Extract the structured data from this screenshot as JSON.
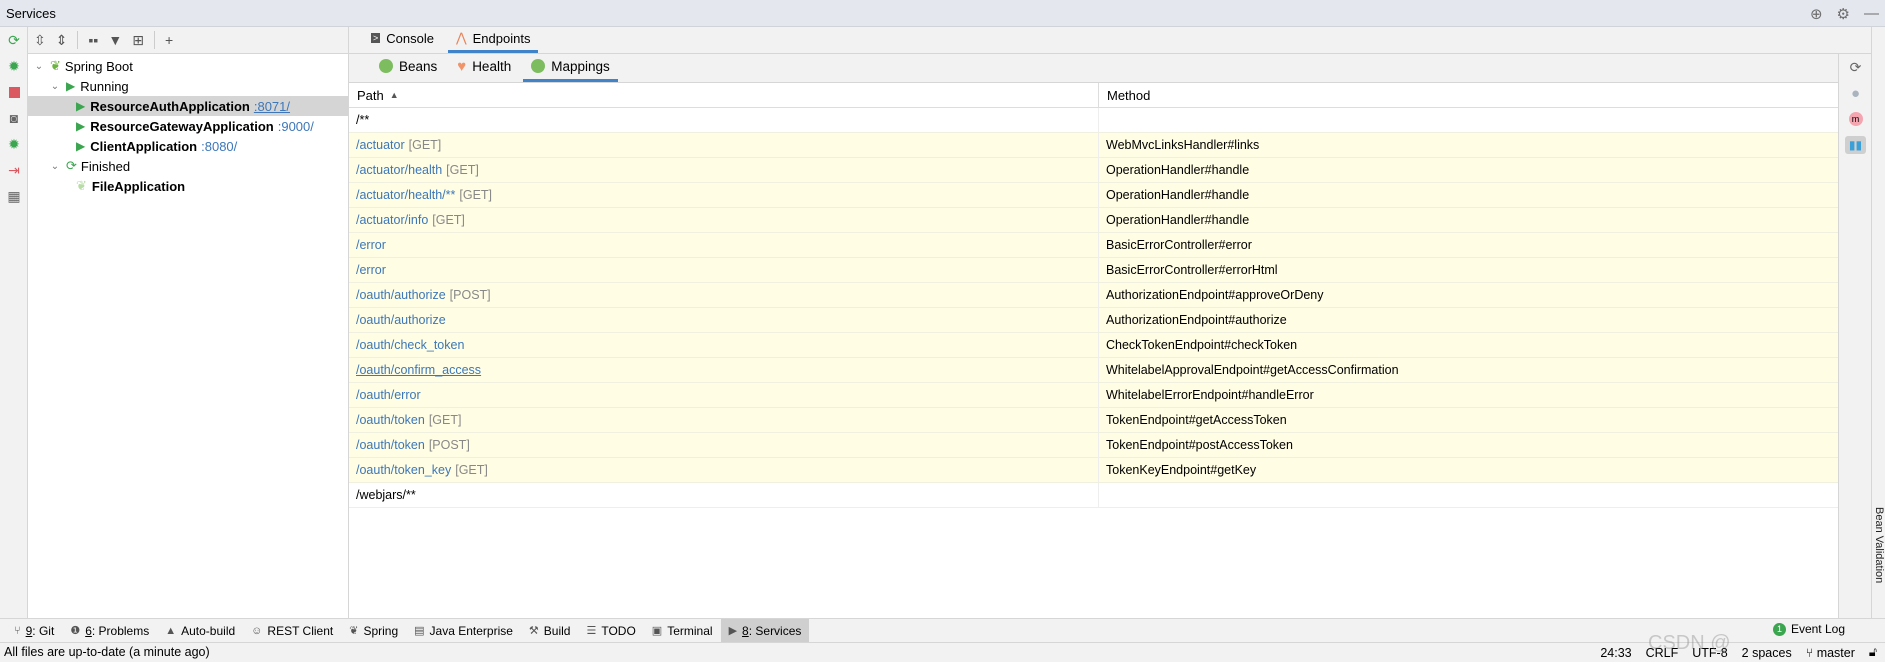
{
  "window": {
    "title": "Services",
    "icons": [
      "crosshair-icon",
      "gear-icon",
      "minimize-icon"
    ]
  },
  "left_toolbar": [
    "refresh-icon",
    "debug-icon",
    "stop-icon",
    "camera-icon",
    "debug-attach-icon",
    "exit-icon",
    "layout-icon"
  ],
  "tree_toolbar": [
    "expand-all-icon",
    "collapse-all-icon",
    "group-icon",
    "filter-icon",
    "new-tab-icon",
    "add-icon"
  ],
  "tree": {
    "root": "Spring Boot",
    "running_label": "Running",
    "running": [
      {
        "name": "ResourceAuthApplication",
        "port": ":8071/",
        "selected": true
      },
      {
        "name": "ResourceGatewayApplication",
        "port": ":9000/"
      },
      {
        "name": "ClientApplication",
        "port": ":8080/"
      }
    ],
    "finished_label": "Finished",
    "finished": [
      {
        "name": "FileApplication"
      }
    ]
  },
  "tabs": [
    {
      "label": "Console"
    },
    {
      "label": "Endpoints",
      "active": true
    }
  ],
  "subtabs": [
    {
      "label": "Beans"
    },
    {
      "label": "Health"
    },
    {
      "label": "Mappings",
      "active": true
    }
  ],
  "table": {
    "columns": [
      "Path",
      "Method"
    ],
    "sort": "ascending",
    "rows": [
      {
        "path": "/**",
        "verb": "",
        "method": "",
        "highlight": false
      },
      {
        "path": "/actuator",
        "verb": "[GET]",
        "method": "WebMvcLinksHandler#links",
        "highlight": true
      },
      {
        "path": "/actuator/health",
        "verb": "[GET]",
        "method": "OperationHandler#handle",
        "highlight": true
      },
      {
        "path": "/actuator/health/**",
        "verb": "[GET]",
        "method": "OperationHandler#handle",
        "highlight": true
      },
      {
        "path": "/actuator/info",
        "verb": "[GET]",
        "method": "OperationHandler#handle",
        "highlight": true
      },
      {
        "path": "/error",
        "verb": "",
        "method": "BasicErrorController#error",
        "highlight": true
      },
      {
        "path": "/error",
        "verb": "",
        "method": "BasicErrorController#errorHtml",
        "highlight": true
      },
      {
        "path": "/oauth/authorize",
        "verb": "[POST]",
        "method": "AuthorizationEndpoint#approveOrDeny",
        "highlight": true
      },
      {
        "path": "/oauth/authorize",
        "verb": "",
        "method": "AuthorizationEndpoint#authorize",
        "highlight": true
      },
      {
        "path": "/oauth/check_token",
        "verb": "",
        "method": "CheckTokenEndpoint#checkToken",
        "highlight": true
      },
      {
        "path": "/oauth/confirm_access",
        "verb": "",
        "method": "WhitelabelApprovalEndpoint#getAccessConfirmation",
        "highlight": true,
        "hovered": true
      },
      {
        "path": "/oauth/error",
        "verb": "",
        "method": "WhitelabelErrorEndpoint#handleError",
        "highlight": true
      },
      {
        "path": "/oauth/token",
        "verb": "[GET]",
        "method": "TokenEndpoint#getAccessToken",
        "highlight": true
      },
      {
        "path": "/oauth/token",
        "verb": "[POST]",
        "method": "TokenEndpoint#postAccessToken",
        "highlight": true
      },
      {
        "path": "/oauth/token_key",
        "verb": "[GET]",
        "method": "TokenKeyEndpoint#getKey",
        "highlight": true
      },
      {
        "path": "/webjars/**",
        "verb": "",
        "method": "",
        "highlight": false
      }
    ]
  },
  "right_toolbar": [
    "refresh-icon",
    "globe-icon",
    "maven-icon",
    "chart-icon"
  ],
  "edge_panel": "Bean Validation",
  "bottom_tools": [
    {
      "num": "9",
      "label": ": Git"
    },
    {
      "num": "6",
      "label": ": Problems"
    },
    {
      "num": "",
      "label": "Auto-build"
    },
    {
      "num": "",
      "label": "REST Client"
    },
    {
      "num": "",
      "label": "Spring"
    },
    {
      "num": "",
      "label": "Java Enterprise"
    },
    {
      "num": "",
      "label": "Build"
    },
    {
      "num": "",
      "label": "TODO"
    },
    {
      "num": "",
      "label": "Terminal"
    },
    {
      "num": "8",
      "label": ": Services",
      "active": true
    }
  ],
  "event_log": {
    "label": "Event Log",
    "count": "1"
  },
  "status": {
    "message": "All files are up-to-date (a minute ago)",
    "position": "24:33",
    "line_sep": "CRLF",
    "encoding": "UTF-8",
    "indent": "2 spaces",
    "branch": "master"
  },
  "watermark": "CSDN @",
  "colors": {
    "accent": "#4083c9",
    "link": "#3d77b9",
    "run": "#3ba550",
    "highlight_row": "#fffde3"
  }
}
